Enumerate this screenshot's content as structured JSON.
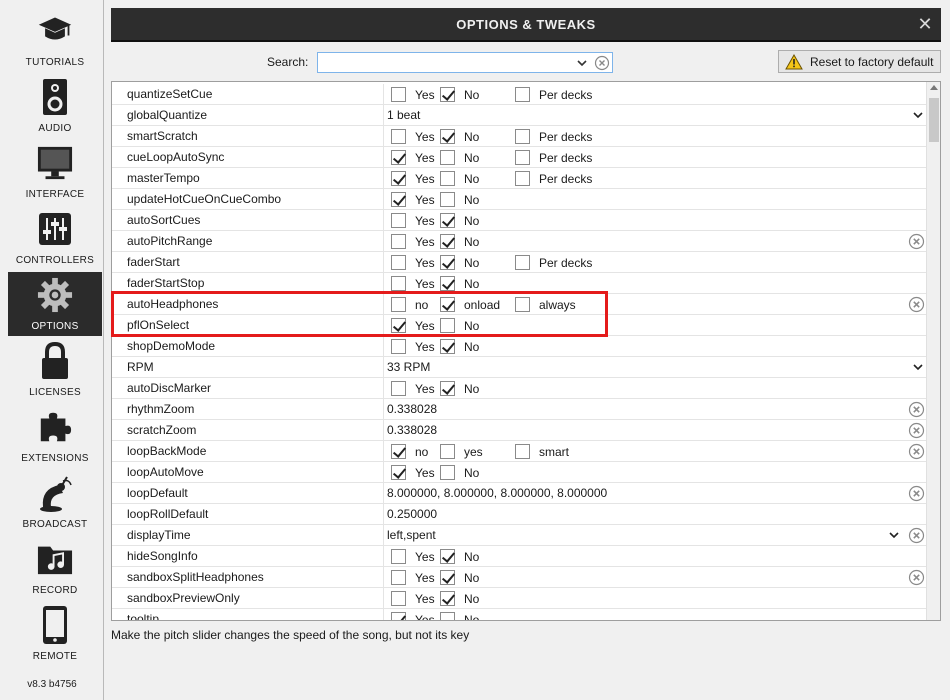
{
  "sidebar": {
    "items": [
      {
        "label": "TUTORIALS",
        "icon": "graduation-cap-icon",
        "active": false
      },
      {
        "label": "AUDIO",
        "icon": "speaker-icon",
        "active": false
      },
      {
        "label": "INTERFACE",
        "icon": "monitor-icon",
        "active": false
      },
      {
        "label": "CONTROLLERS",
        "icon": "sliders-icon",
        "active": false
      },
      {
        "label": "OPTIONS",
        "icon": "gear-icon",
        "active": true
      },
      {
        "label": "LICENSES",
        "icon": "lock-icon",
        "active": false
      },
      {
        "label": "EXTENSIONS",
        "icon": "puzzle-icon",
        "active": false
      },
      {
        "label": "BROADCAST",
        "icon": "broadcast-icon",
        "active": false
      },
      {
        "label": "RECORD",
        "icon": "music-folder-icon",
        "active": false
      },
      {
        "label": "REMOTE",
        "icon": "phone-icon",
        "active": false
      }
    ],
    "version": "v8.3 b4756"
  },
  "window": {
    "title": "OPTIONS & TWEAKS",
    "close": "✕"
  },
  "search": {
    "label": "Search:",
    "value": "",
    "placeholder": ""
  },
  "reset_button": {
    "label": "Reset to factory default"
  },
  "colors": {
    "active_bg": "#2b2b2b",
    "titlebar": "#2d2d2d",
    "highlight": "#e41b1b"
  },
  "rows": [
    {
      "name": "quantizeSetCue",
      "type": "checks",
      "options": [
        {
          "label": "Yes",
          "checked": false
        },
        {
          "label": "No",
          "checked": true
        },
        {
          "label": "Per decks",
          "checked": false
        }
      ]
    },
    {
      "name": "globalQuantize",
      "type": "select",
      "value": "1 beat"
    },
    {
      "name": "smartScratch",
      "type": "checks",
      "options": [
        {
          "label": "Yes",
          "checked": false
        },
        {
          "label": "No",
          "checked": true
        },
        {
          "label": "Per decks",
          "checked": false
        }
      ]
    },
    {
      "name": "cueLoopAutoSync",
      "type": "checks",
      "options": [
        {
          "label": "Yes",
          "checked": true
        },
        {
          "label": "No",
          "checked": false
        },
        {
          "label": "Per decks",
          "checked": false
        }
      ]
    },
    {
      "name": "masterTempo",
      "type": "checks",
      "options": [
        {
          "label": "Yes",
          "checked": true
        },
        {
          "label": "No",
          "checked": false
        },
        {
          "label": "Per decks",
          "checked": false
        }
      ]
    },
    {
      "name": "updateHotCueOnCueCombo",
      "type": "checks",
      "options": [
        {
          "label": "Yes",
          "checked": true
        },
        {
          "label": "No",
          "checked": false
        }
      ]
    },
    {
      "name": "autoSortCues",
      "type": "checks",
      "options": [
        {
          "label": "Yes",
          "checked": false
        },
        {
          "label": "No",
          "checked": true
        }
      ]
    },
    {
      "name": "autoPitchRange",
      "type": "checks",
      "clear": true,
      "options": [
        {
          "label": "Yes",
          "checked": false
        },
        {
          "label": "No",
          "checked": true
        }
      ]
    },
    {
      "name": "faderStart",
      "type": "checks",
      "options": [
        {
          "label": "Yes",
          "checked": false
        },
        {
          "label": "No",
          "checked": true
        },
        {
          "label": "Per decks",
          "checked": false
        }
      ]
    },
    {
      "name": "faderStartStop",
      "type": "checks",
      "options": [
        {
          "label": "Yes",
          "checked": false
        },
        {
          "label": "No",
          "checked": true
        }
      ]
    },
    {
      "name": "autoHeadphones",
      "type": "checks",
      "clear": true,
      "options": [
        {
          "label": "no",
          "checked": false
        },
        {
          "label": "onload",
          "checked": true
        },
        {
          "label": "always",
          "checked": false
        }
      ]
    },
    {
      "name": "pflOnSelect",
      "type": "checks",
      "options": [
        {
          "label": "Yes",
          "checked": true
        },
        {
          "label": "No",
          "checked": false
        }
      ]
    },
    {
      "name": "shopDemoMode",
      "type": "checks",
      "options": [
        {
          "label": "Yes",
          "checked": false
        },
        {
          "label": "No",
          "checked": true
        }
      ]
    },
    {
      "name": "RPM",
      "type": "select",
      "value": "33 RPM"
    },
    {
      "name": "autoDiscMarker",
      "type": "checks",
      "options": [
        {
          "label": "Yes",
          "checked": false
        },
        {
          "label": "No",
          "checked": true
        }
      ]
    },
    {
      "name": "rhythmZoom",
      "type": "text",
      "value": "0.338028",
      "clear": true
    },
    {
      "name": "scratchZoom",
      "type": "text",
      "value": "0.338028",
      "clear": true
    },
    {
      "name": "loopBackMode",
      "type": "checks",
      "clear": true,
      "options": [
        {
          "label": "no",
          "checked": true
        },
        {
          "label": "yes",
          "checked": false
        },
        {
          "label": "smart",
          "checked": false
        }
      ]
    },
    {
      "name": "loopAutoMove",
      "type": "checks",
      "options": [
        {
          "label": "Yes",
          "checked": true
        },
        {
          "label": "No",
          "checked": false
        }
      ]
    },
    {
      "name": "loopDefault",
      "type": "text",
      "value": "8.000000, 8.000000, 8.000000, 8.000000",
      "clear": true
    },
    {
      "name": "loopRollDefault",
      "type": "text",
      "value": "0.250000"
    },
    {
      "name": "displayTime",
      "type": "select",
      "value": "left,spent",
      "clear": true
    },
    {
      "name": "hideSongInfo",
      "type": "checks",
      "options": [
        {
          "label": "Yes",
          "checked": false
        },
        {
          "label": "No",
          "checked": true
        }
      ]
    },
    {
      "name": "sandboxSplitHeadphones",
      "type": "checks",
      "clear": true,
      "options": [
        {
          "label": "Yes",
          "checked": false
        },
        {
          "label": "No",
          "checked": true
        }
      ]
    },
    {
      "name": "sandboxPreviewOnly",
      "type": "checks",
      "options": [
        {
          "label": "Yes",
          "checked": false
        },
        {
          "label": "No",
          "checked": true
        }
      ]
    },
    {
      "name": "tooltip",
      "type": "checks",
      "options": [
        {
          "label": "Yes",
          "checked": true
        },
        {
          "label": "No",
          "checked": false
        }
      ]
    }
  ],
  "description": "Make the pitch slider changes the speed of the song, but not its key"
}
